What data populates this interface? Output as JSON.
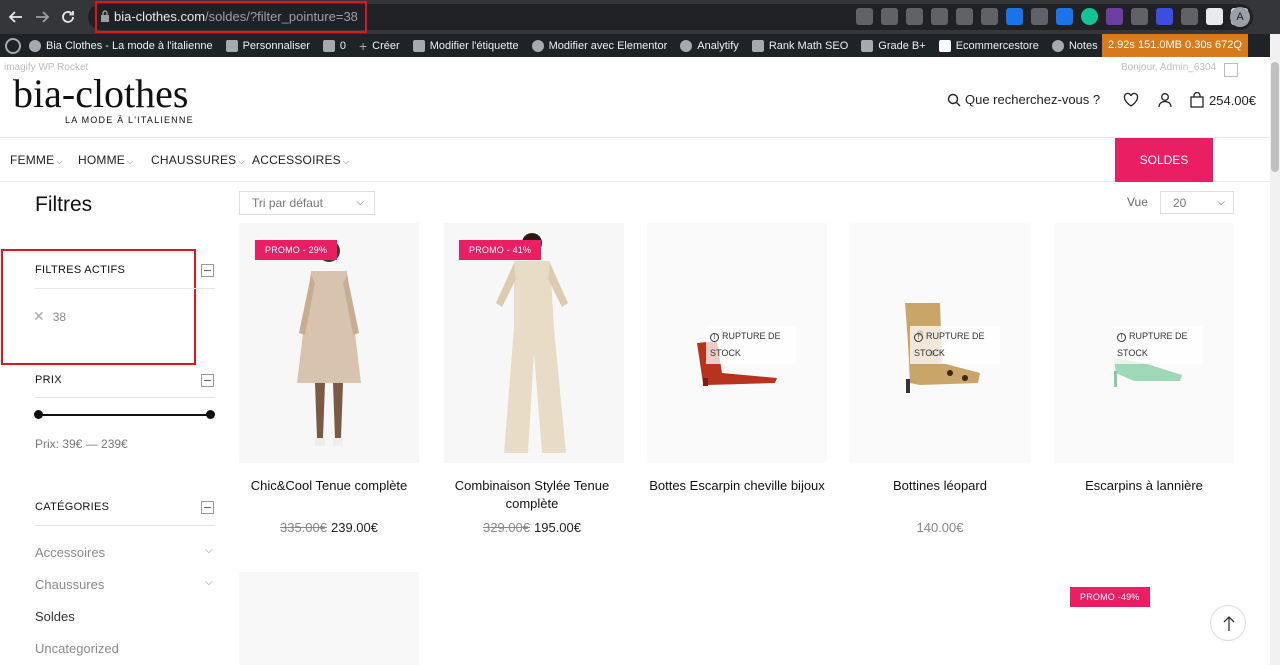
{
  "browser": {
    "url_host": "bia-clothes.com",
    "url_path": "/soldes/?filter_pointure=38",
    "profile_initial": "A",
    "extensions": [
      "translate-icon",
      "share-icon",
      "star-icon",
      "recycle-icon",
      "globe-icon",
      "flag-icon",
      "translate-blue-icon",
      "camera-icon",
      "new-badge-icon",
      "grammarly-icon",
      "counter-28-icon",
      "eye-icon",
      "target-icon",
      "refresh-icon",
      "puzzle-icon",
      "sidepanel-icon"
    ]
  },
  "wpbar": {
    "site": "Bia Clothes - La mode à l'italienne",
    "customize": "Personnaliser",
    "comments": "0",
    "new": "Créer",
    "edit_tag": "Modifier l'étiquette",
    "elementor": "Modifier avec Elementor",
    "analytify": "Analytify",
    "rankmath": "Rank Math SEO",
    "grade": "Grade B+",
    "ecommerce": "Ecommercestore",
    "notes": "Notes",
    "perf": "2.92s  151.0MB  0.30s  672Q"
  },
  "ghost": {
    "left": "imagify    WP Rocket",
    "right": "Bonjour, Admin_6304"
  },
  "header": {
    "logo": "bia-clothes",
    "tagline": "LA MODE À L'ITALIENNE",
    "search_label": "Que recherchez-vous ?",
    "cart_total": "254.00€"
  },
  "menu": {
    "items": [
      "FEMME",
      "HOMME",
      "CHAUSSURES",
      "ACCESSOIRES"
    ],
    "highlight": "SOLDES"
  },
  "sidebar": {
    "title": "Filtres",
    "active_filters_title": "FILTRES ACTIFS",
    "active_filter_value": "38",
    "price_title": "PRIX",
    "price_text": "Prix: 39€ — 239€",
    "categories_title": "CATÉGORIES",
    "categories": [
      "Accessoires",
      "Chaussures",
      "Soldes",
      "Uncategorized"
    ]
  },
  "toolbar": {
    "sort": "Tri par défaut",
    "view_label": "Vue",
    "view_value": "20"
  },
  "products": [
    {
      "name": "Chic&Cool Tenue complète",
      "old_price": "335.00€",
      "price": "239.00€",
      "badge": "PROMO - 29%"
    },
    {
      "name": "Combinaison Stylée Tenue complète",
      "old_price": "329.00€",
      "price": "195.00€",
      "badge": "PROMO - 41%"
    },
    {
      "name": "Bottes Escarpin cheville bijoux",
      "stock": "RUPTURE DE STOCK"
    },
    {
      "name": "Bottines léopard",
      "price": "140.00€",
      "stock": "RUPTURE DE STOCK"
    },
    {
      "name": "Escarpins à lannière",
      "stock": "RUPTURE DE STOCK"
    }
  ],
  "bottom_badge": "PROMO -49%",
  "colors": {
    "accent": "#e91e63",
    "highlight_box": "#e0161d",
    "wpbar": "#1d2327",
    "perf": "#d77a1e"
  }
}
